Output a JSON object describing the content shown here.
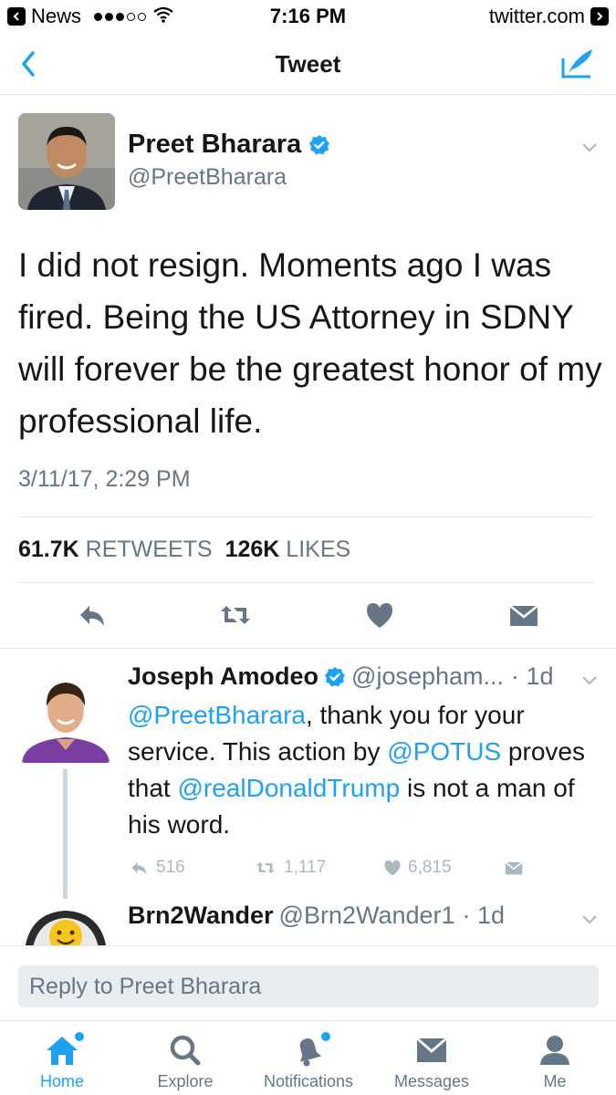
{
  "status_bar": {
    "back_app": "News",
    "time": "7:16 PM",
    "site": "twitter.com"
  },
  "nav": {
    "title": "Tweet"
  },
  "tweet": {
    "author_name": "Preet Bharara",
    "author_handle": "@PreetBharara",
    "text": "I did not resign. Moments ago I was fired. Being the US Attorney in SDNY will forever be the greatest honor of my professional life.",
    "timestamp": "3/11/17, 2:29 PM",
    "retweets_count": "61.7K",
    "retweets_label": "RETWEETS",
    "likes_count": "126K",
    "likes_label": "LIKES"
  },
  "replies": [
    {
      "name": "Joseph Amodeo",
      "handle": "@josepham...",
      "time": "· 1d",
      "text_parts": {
        "m1": "@PreetBharara",
        "t1": ", thank you for your service. This action by ",
        "m2": "@POTUS",
        "t2": " proves that ",
        "m3": "@realDonaldTrump",
        "t3": " is not a man of his word."
      },
      "reply_count": "516",
      "retweet_count": "1,117",
      "like_count": "6,815"
    },
    {
      "name": "Brn2Wander",
      "handle": "@Brn2Wander1",
      "time": "· 1d"
    }
  ],
  "reply_box": {
    "placeholder": "Reply to Preet Bharara"
  },
  "tabs": [
    {
      "label": "Home"
    },
    {
      "label": "Explore"
    },
    {
      "label": "Notifications"
    },
    {
      "label": "Messages"
    },
    {
      "label": "Me"
    }
  ],
  "colors": {
    "accent": "#1da1f2",
    "secondary_text": "#657786",
    "divider": "#e1e8ed"
  }
}
